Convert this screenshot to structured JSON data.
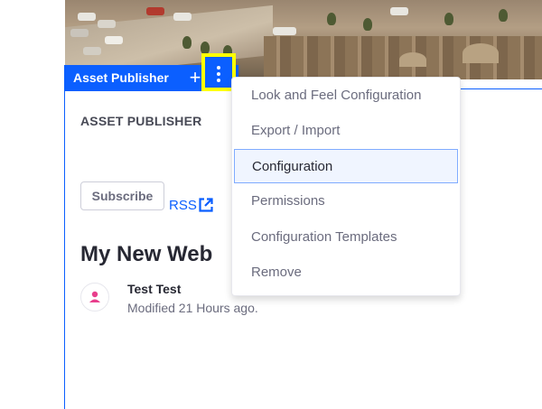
{
  "portlet": {
    "topper_title": "Asset Publisher",
    "add_symbol": "+",
    "heading": "ASSET PUBLISHER",
    "subscribe_label": "Subscribe",
    "rss_label": "RSS",
    "entry_title": "My New Web",
    "author": "Test Test",
    "modified": "Modified 21 Hours ago."
  },
  "menu": {
    "items": [
      {
        "label": "Look and Feel Configuration",
        "active": false
      },
      {
        "label": "Export / Import",
        "active": false
      },
      {
        "label": "Configuration",
        "active": true
      },
      {
        "label": "Permissions",
        "active": false
      },
      {
        "label": "Configuration Templates",
        "active": false
      },
      {
        "label": "Remove",
        "active": false
      }
    ]
  },
  "icons": {
    "options": "vertical-ellipsis-icon",
    "add": "plus-icon",
    "rss": "external-link-icon",
    "avatar": "user-icon"
  },
  "colors": {
    "accent": "#0b5fff",
    "highlight": "#ffff00",
    "avatar": "#e83e8c"
  }
}
